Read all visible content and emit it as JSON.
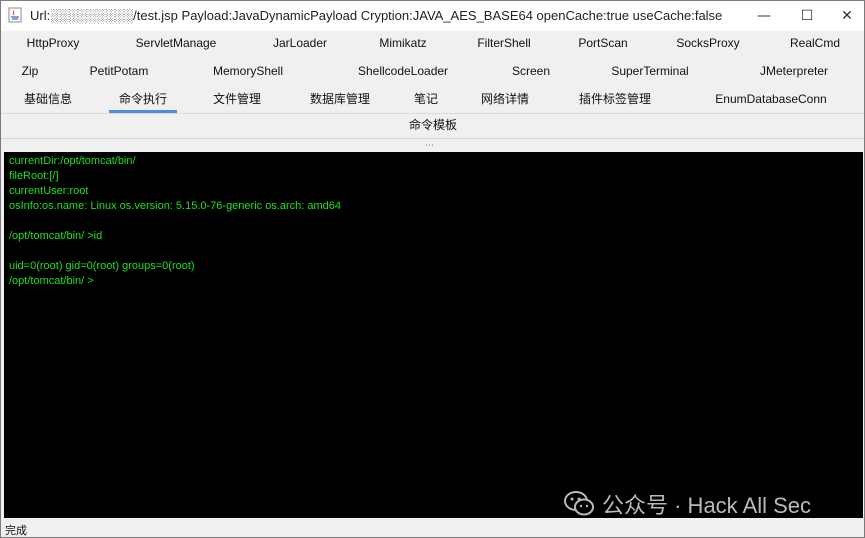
{
  "window": {
    "title": "Url:░░░░░░░░░/test.jsp Payload:JavaDynamicPayload Cryption:JAVA_AES_BASE64 openCache:true useCache:false",
    "minimize_glyph": "—",
    "maximize_glyph": "☐",
    "close_glyph": "✕"
  },
  "tabs": {
    "row1": [
      "HttpProxy",
      "ServletManage",
      "JarLoader",
      "Mimikatz",
      "FilterShell",
      "PortScan",
      "SocksProxy",
      "RealCmd"
    ],
    "row2": [
      "Zip",
      "PetitPotam",
      "MemoryShell",
      "ShellcodeLoader",
      "Screen",
      "SuperTerminal",
      "JMeterpreter"
    ],
    "row3": [
      "基础信息",
      "命令执行",
      "文件管理",
      "数据库管理",
      "笔记",
      "网络详情",
      "插件标签管理",
      "EnumDatabaseConn"
    ],
    "active": "命令执行"
  },
  "subtab": {
    "label": "命令模板"
  },
  "terminal": {
    "lines": [
      "currentDir:/opt/tomcat/bin/",
      "fileRoot:[/]",
      "currentUser:root",
      "osInfo:os.name: Linux os.version: 5.15.0-76-generic os.arch: amd64",
      "",
      "/opt/tomcat/bin/ >id",
      "",
      "uid=0(root) gid=0(root) groups=0(root)",
      "/opt/tomcat/bin/ >"
    ],
    "text_color": "#1de01d",
    "background": "#000000"
  },
  "watermark": {
    "text": "公众号 · Hack All Sec",
    "icon": "wechat-icon"
  },
  "statusbar": {
    "text": "完成"
  },
  "colors": {
    "active_tab_underline": "#4a90d9",
    "window_bg": "#f0f0f0"
  }
}
